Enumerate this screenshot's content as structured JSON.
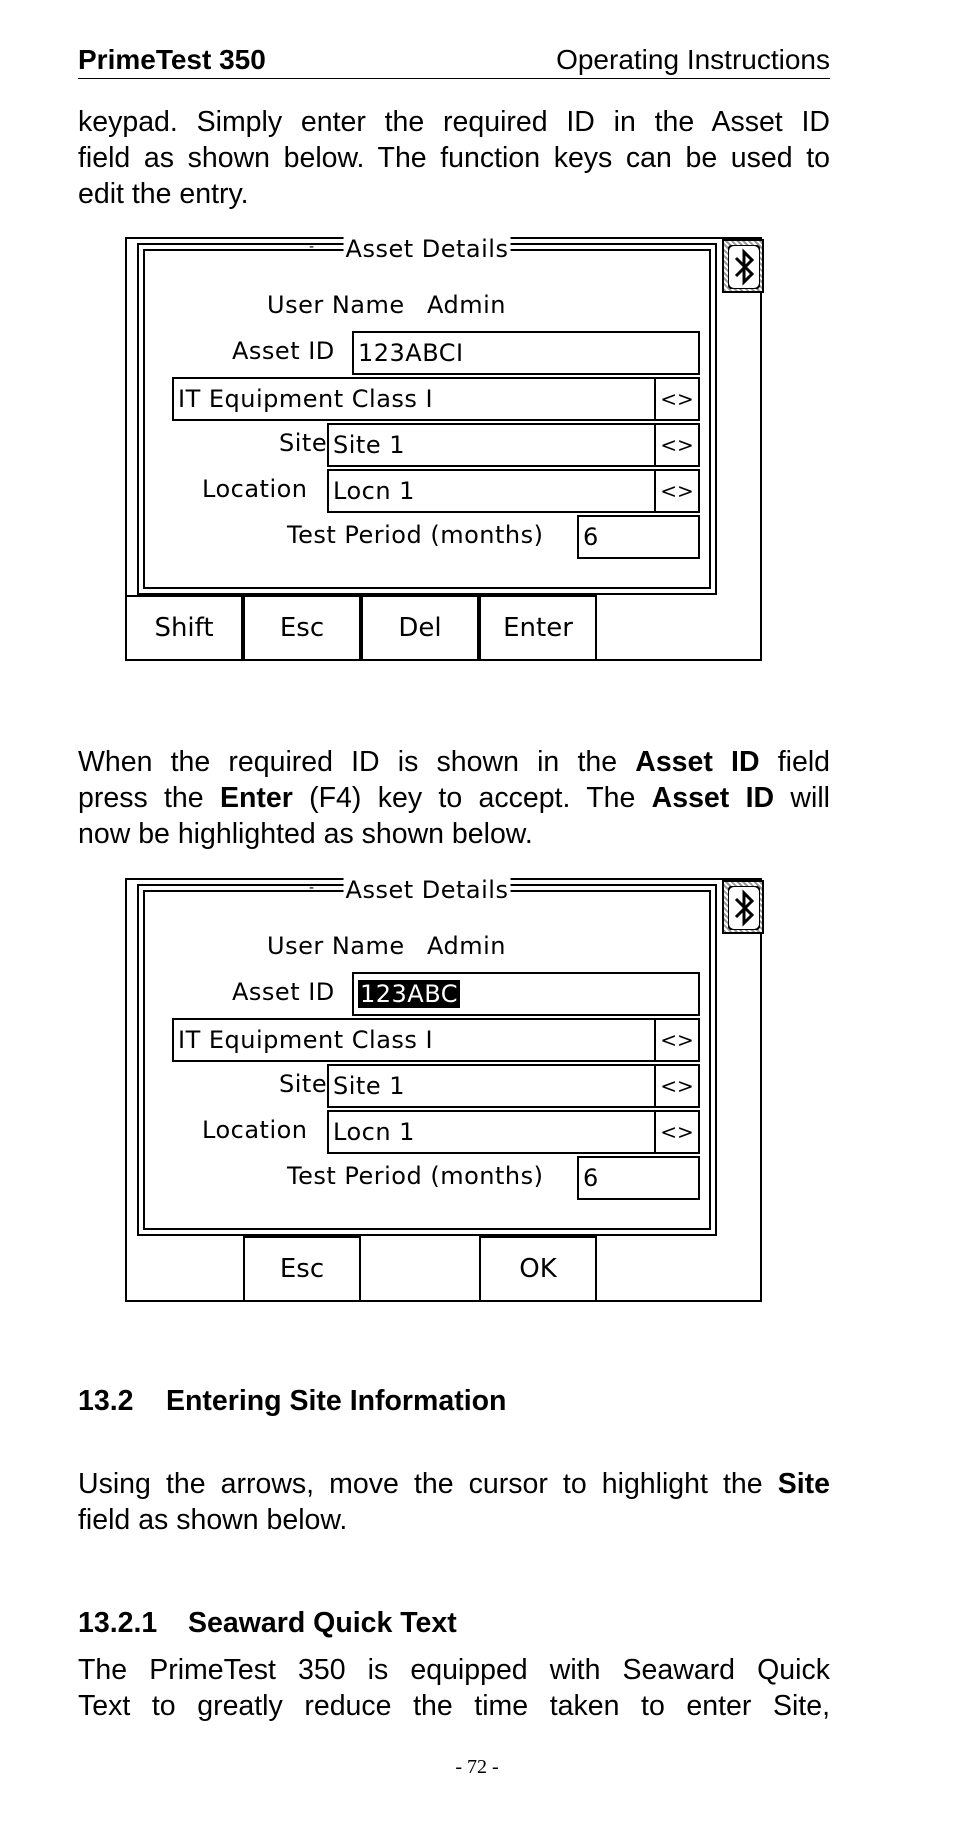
{
  "header": {
    "title": "PrimeTest 350",
    "section": "Operating Instructions"
  },
  "para1": [
    "keypad. Simply enter the required ID in the Asset ID",
    "field as shown below. The function keys can be used to",
    "edit the entry."
  ],
  "screen1": {
    "title": "Asset Details",
    "user_name_label": "User Name",
    "user_name_value": "Admin",
    "asset_id_label": "Asset ID",
    "asset_id_value": "123ABCI",
    "class_value": "IT Equipment Class I",
    "arrows": "<>",
    "site_label": "Site",
    "site_value": "Site 1",
    "location_label": "Location",
    "location_value": "Locn 1",
    "period_label": "Test Period (months)",
    "period_value": "6",
    "f1": "Shift",
    "f2": "Esc",
    "f3": "Del",
    "f4": "Enter"
  },
  "para2": {
    "l1a": "When the required ID is shown in the",
    "l1b": "Asset ID",
    "l1c": "field",
    "l2a": "press the",
    "l2b": "Enter",
    "l2c": "(F4) key to accept. The",
    "l2d": "Asset ID",
    "l2e": "will",
    "l3": "now be highlighted as shown below."
  },
  "screen2": {
    "title": "Asset Details",
    "user_name_label": "User Name",
    "user_name_value": "Admin",
    "asset_id_label": "Asset ID",
    "asset_id_value": "123ABC",
    "class_value": "IT Equipment Class I",
    "arrows": "<>",
    "site_label": "Site",
    "site_value": "Site 1",
    "location_label": "Location",
    "location_value": "Locn 1",
    "period_label": "Test Period (months)",
    "period_value": "6",
    "f2": "Esc",
    "f4": "OK"
  },
  "section_13_2": {
    "num": "13.2",
    "title": "Entering Site Information"
  },
  "para3": {
    "l1a": "Using the arrows, move the cursor to highlight the",
    "l1b": "Site",
    "l2": "field as shown below."
  },
  "section_13_2_1": {
    "num": "13.2.1",
    "title": "Seaward Quick Text"
  },
  "para4": [
    "The PrimeTest 350 is equipped with Seaward Quick",
    "Text to greatly reduce the time taken to enter Site,"
  ],
  "page_number": "- 72 -"
}
